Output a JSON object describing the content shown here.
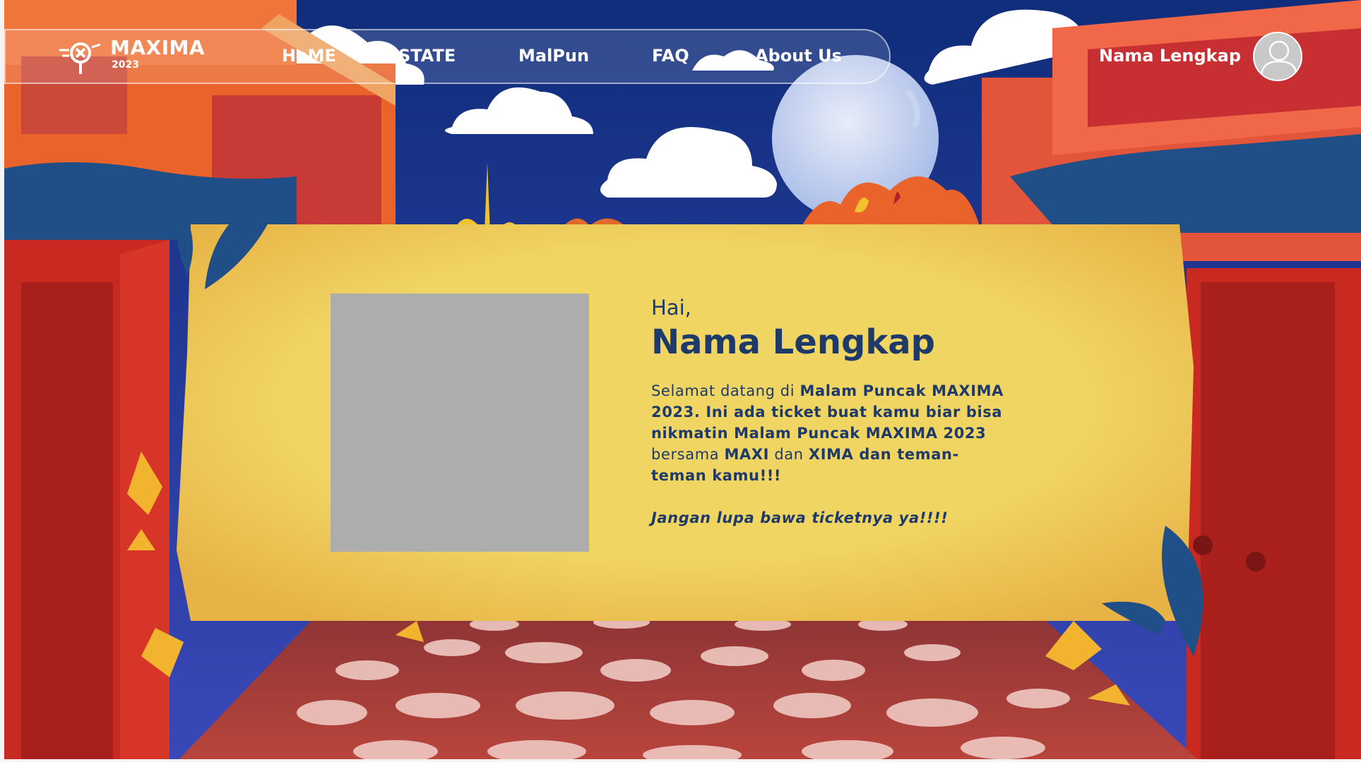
{
  "brand": {
    "name": "MAXIMA",
    "year": "2023",
    "logo_icon": "maxima-logo-icon"
  },
  "nav": {
    "items": [
      {
        "label": "HoME",
        "id": "home"
      },
      {
        "label": "STATE",
        "id": "state"
      },
      {
        "label": "MalPun",
        "id": "malpun"
      },
      {
        "label": "FAQ",
        "id": "faq"
      },
      {
        "label": "About Us",
        "id": "about-us"
      }
    ]
  },
  "user": {
    "name": "Nama Lengkap",
    "avatar_icon": "user-avatar-icon"
  },
  "greeting": {
    "hai": "Hai,",
    "name": "Nama Lengkap",
    "message": {
      "t1": "Selamat datang di ",
      "b1": "Malam Puncak MAXIMA 2023",
      "t2": ". Ini ada ticket buat kamu biar bisa nikmatin ",
      "b2": "Malam Puncak MAXIMA 2023",
      "t3": " bersama ",
      "b3": "MAXI",
      "t4": " dan ",
      "b4": "XIMA",
      "t5": " dan teman-teman kamu!!!"
    },
    "reminder": "Jangan lupa bawa ticketnya ya!!!!"
  },
  "colors": {
    "sky_top": "#0f2d7a",
    "sky_bottom": "#3a48b8",
    "banner": "#efd060",
    "text_primary": "#1e3a6b",
    "building_red": "#c82a22",
    "building_orange": "#e9632a",
    "roof_blue": "#1f4f86",
    "path": "#a3403a",
    "stone": "#f0c8c2"
  }
}
